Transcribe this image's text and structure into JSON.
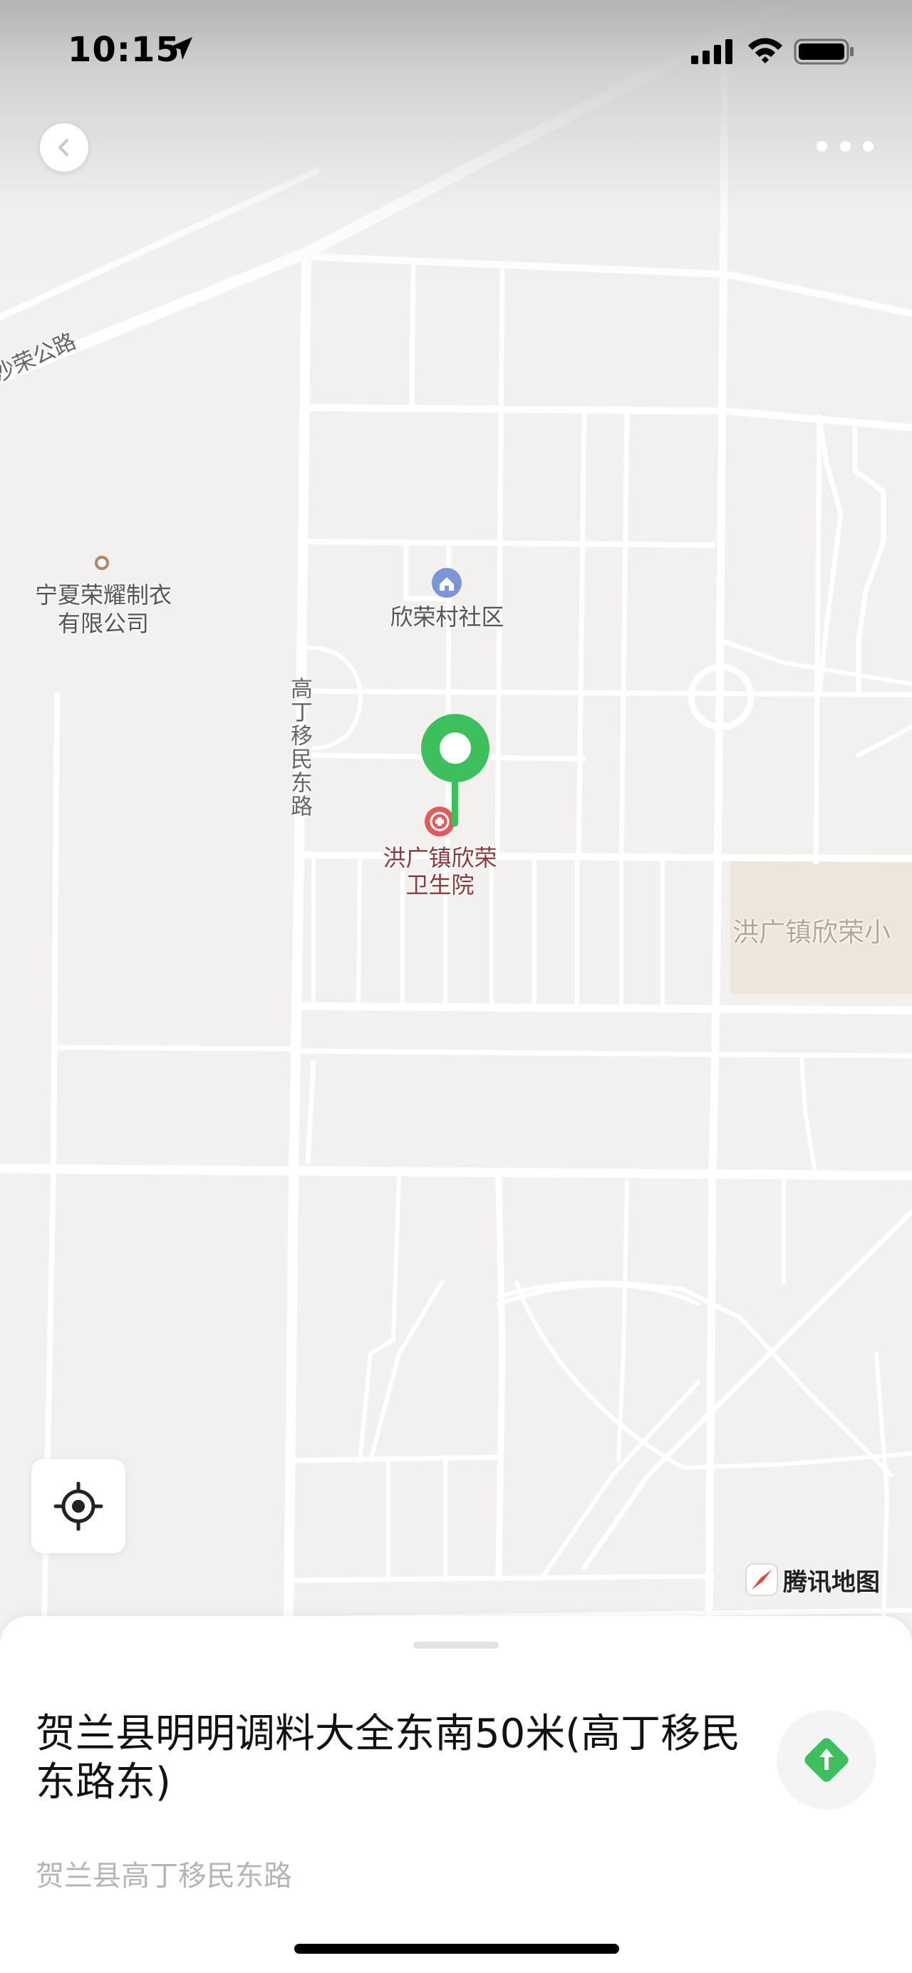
{
  "status_bar": {
    "time": "10:15",
    "icons": [
      "location-arrow-icon",
      "cellular-signal-icon",
      "wifi-icon",
      "battery-icon"
    ]
  },
  "top_bar": {
    "back_icon": "chevron-left-icon",
    "more_icon": "more-dots-icon"
  },
  "map": {
    "labels": {
      "road_shارong": "沙荣公路",
      "road_gaoding": "高丁移民东路",
      "company_line1": "宁夏荣耀制衣",
      "company_line2": "有限公司",
      "community": "欣荣村社区",
      "hospital_line1": "洪广镇欣荣",
      "hospital_line2": "卫生院",
      "school_partial": "洪广镇欣荣小"
    },
    "icons": {
      "community": "home-icon",
      "hospital": "hospital-icon",
      "company": "poi-dot-icon",
      "marker": "map-pin-icon"
    },
    "colors": {
      "background": "#f2f1ef",
      "road": "#ffffff",
      "marker": "#3cbf5c",
      "hospital": "#e25b5b",
      "community": "#7b95d8",
      "area": "#ece6dc"
    },
    "watermark": "腾讯地图"
  },
  "locate_button": {
    "icon": "locate-crosshair-icon"
  },
  "sheet": {
    "title": "贺兰县明明调料大全东南50米(高丁移民东路东)",
    "subtitle": "贺兰县高丁移民东路",
    "nav_icon": "navigate-arrow-icon",
    "nav_color": "#3cbf5c"
  }
}
